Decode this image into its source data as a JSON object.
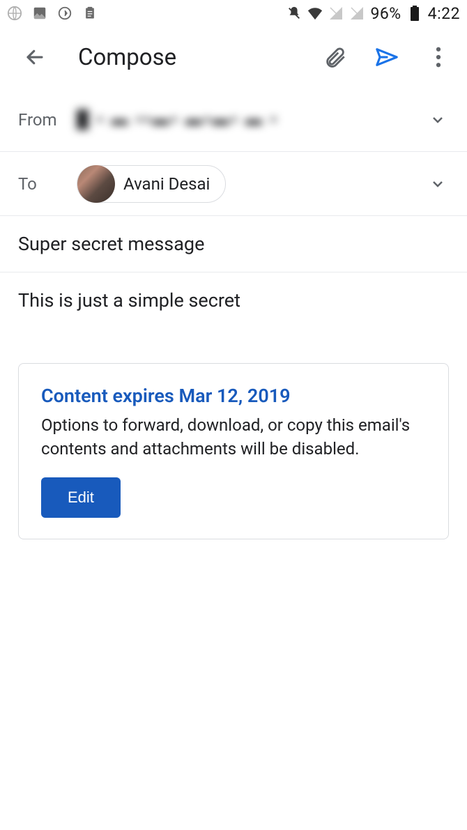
{
  "status_bar": {
    "battery_percent": "96%",
    "time": "4:22"
  },
  "header": {
    "title": "Compose"
  },
  "fields": {
    "from_label": "From",
    "from_value": "█ ▪ ▬ ▪▪▬▪ ▬▪▬▪ ▬ ▪",
    "to_label": "To",
    "to_chip_name": "Avani Desai"
  },
  "subject": "Super secret message",
  "body": "This is just a simple secret",
  "confidential": {
    "title": "Content expires Mar 12, 2019",
    "description": "Options to forward, download, or copy this email's contents and attachments will be disabled.",
    "button_label": "Edit"
  }
}
